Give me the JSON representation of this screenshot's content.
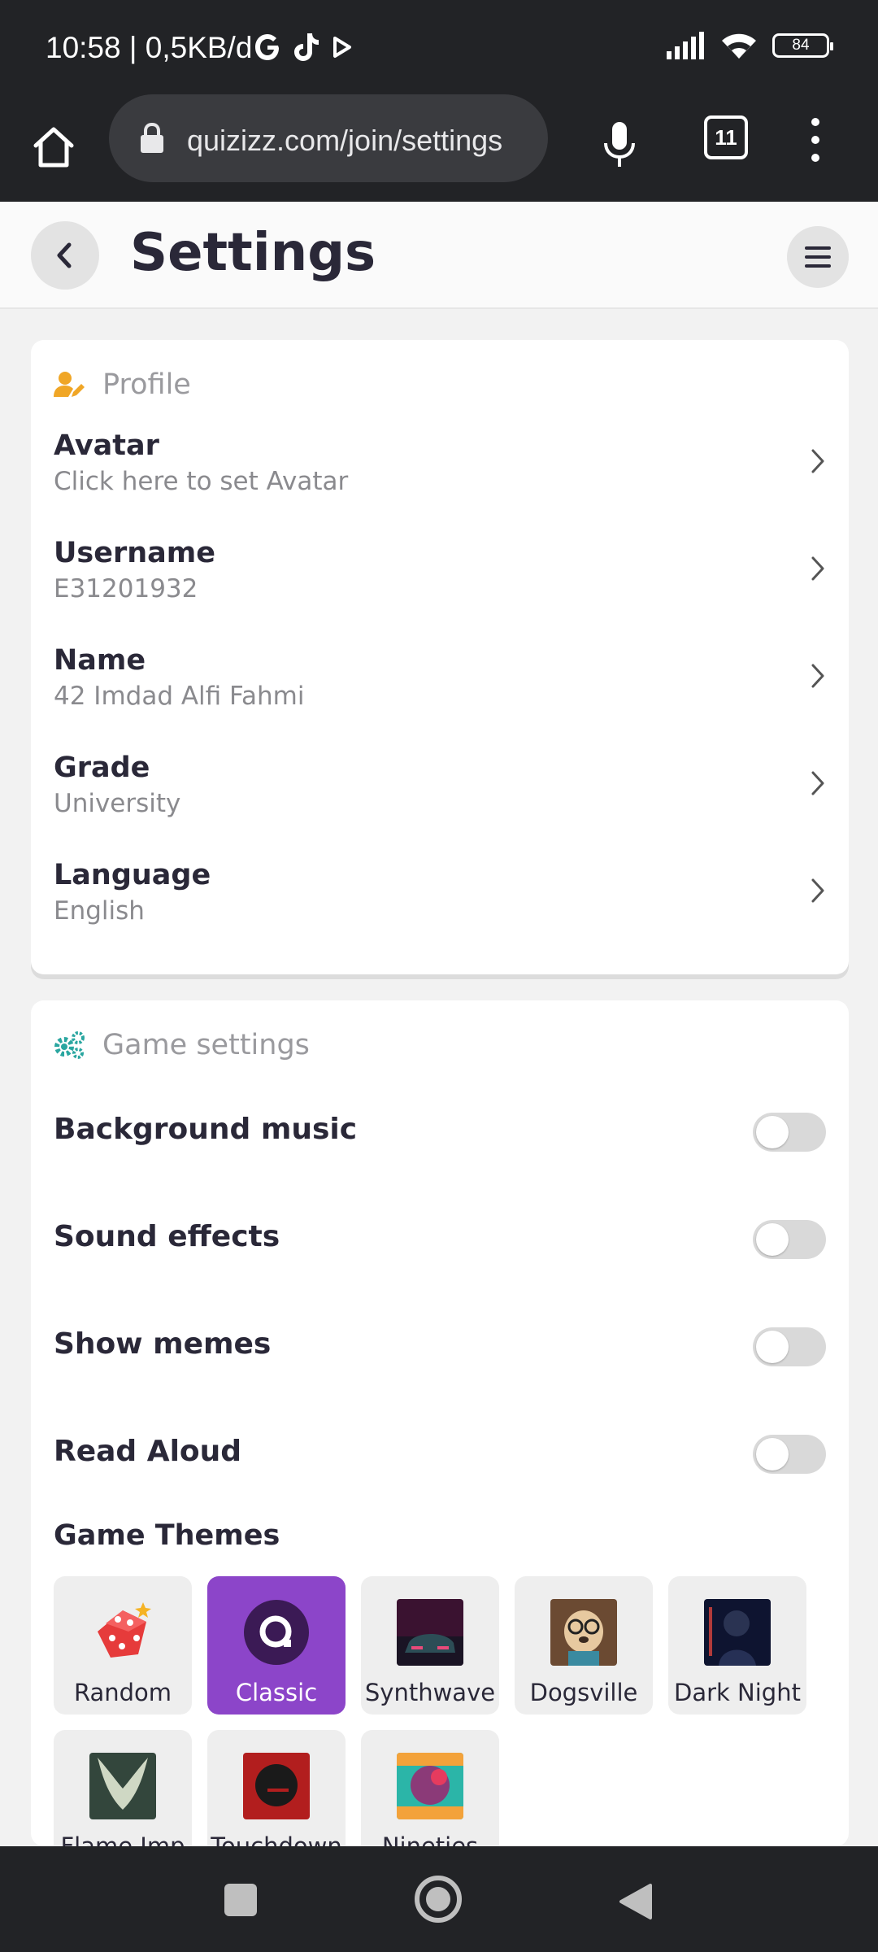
{
  "status": {
    "time": "10:58 | 0,5KB/d",
    "battery": "84"
  },
  "browser": {
    "url": "quizizz.com/join/settings",
    "tab_count": "11"
  },
  "header": {
    "title": "Settings"
  },
  "profile": {
    "section_title": "Profile",
    "rows": [
      {
        "label": "Avatar",
        "value": "Click here to set Avatar"
      },
      {
        "label": "Username",
        "value": "E31201932"
      },
      {
        "label": "Name",
        "value": "42 Imdad Alfi Fahmi"
      },
      {
        "label": "Grade",
        "value": "University"
      },
      {
        "label": "Language",
        "value": "English"
      }
    ]
  },
  "game": {
    "section_title": "Game settings",
    "toggles": [
      {
        "label": "Background music",
        "on": false
      },
      {
        "label": "Sound effects",
        "on": false
      },
      {
        "label": "Show memes",
        "on": false
      },
      {
        "label": "Read Aloud",
        "on": false
      }
    ],
    "themes_title": "Game Themes",
    "themes": [
      {
        "label": "Random",
        "selected": false
      },
      {
        "label": "Classic",
        "selected": true
      },
      {
        "label": "Synthwave",
        "selected": false
      },
      {
        "label": "Dogsville",
        "selected": false
      },
      {
        "label": "Dark Night",
        "selected": false
      },
      {
        "label": "Flame Imp",
        "selected": false
      },
      {
        "label": "Touchdown",
        "selected": false
      },
      {
        "label": "Nineties",
        "selected": false
      }
    ]
  },
  "colors": {
    "accent": "#8c45c9",
    "profile_icon": "#f0a626",
    "game_icon": "#2aa6a0",
    "text_dark": "#2a2838"
  },
  "icons": {
    "home": "home-icon",
    "lock": "lock-icon",
    "mic": "mic-icon",
    "back": "chevron-left-icon",
    "menu": "hamburger-icon",
    "row_chevron": "chevron-right-icon"
  }
}
